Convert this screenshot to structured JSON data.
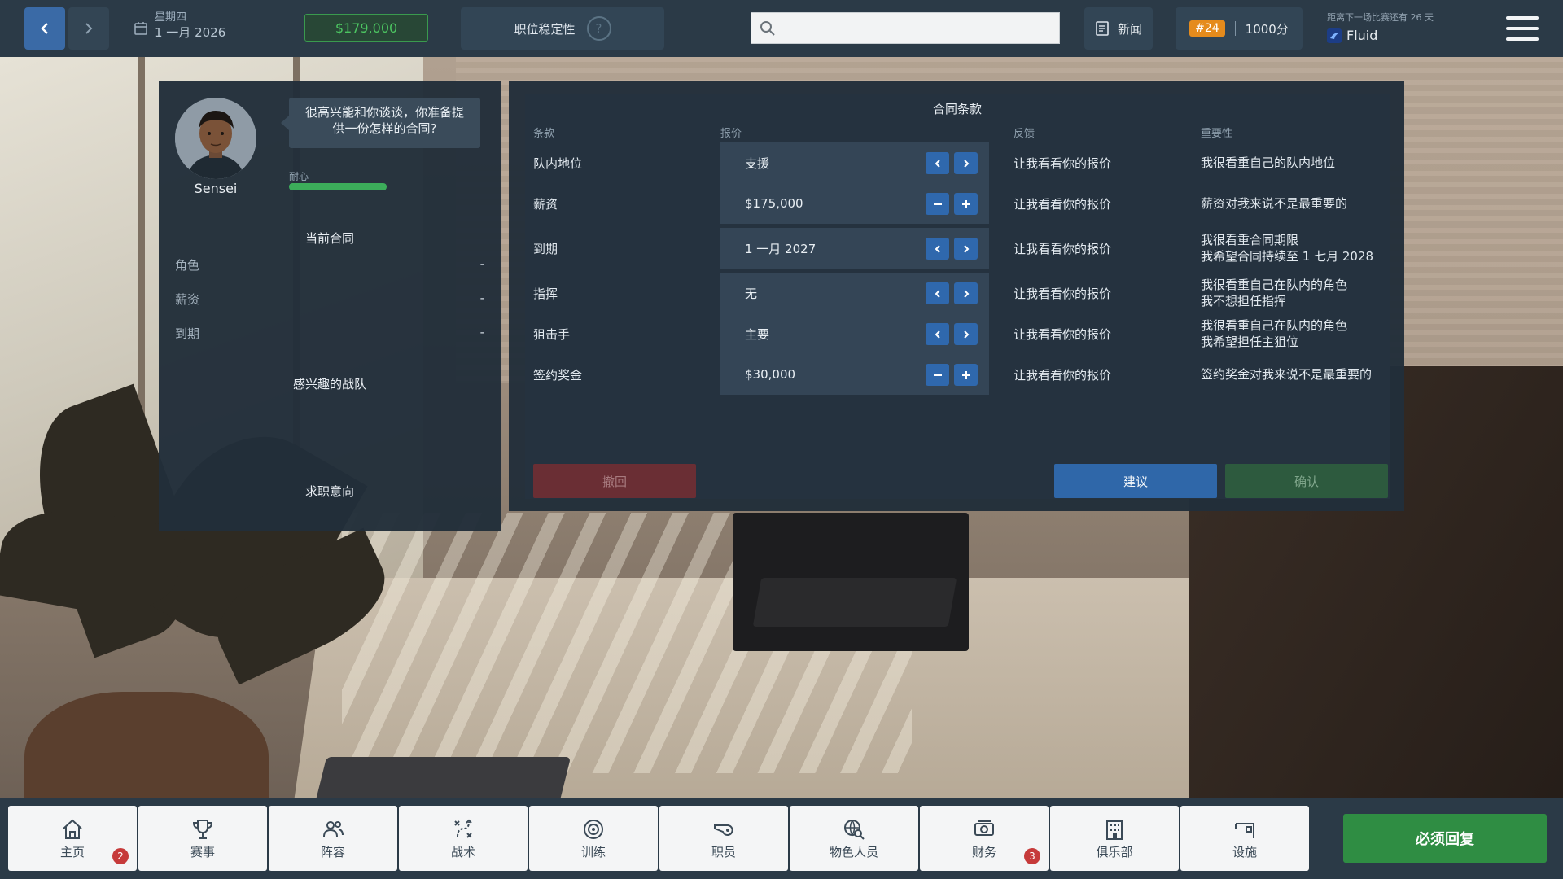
{
  "topbar": {
    "weekday": "星期四",
    "date": "1 一月 2026",
    "balance": "$179,000",
    "job_security_label": "职位稳定性",
    "job_security_help": "?",
    "search_placeholder": "",
    "news_label": "新闻",
    "rank": "#24",
    "points": "1000分",
    "next_match_text": "距离下一场比赛还有 26 天",
    "team_name": "Fluid"
  },
  "player": {
    "name": "Sensei",
    "speech": "很高兴能和你谈谈，你准备提供一份怎样的合同?",
    "patience_label": "耐心",
    "patience_fraction": 1.0
  },
  "current_contract": {
    "title": "当前合同",
    "rows": [
      {
        "label": "角色",
        "value": "-"
      },
      {
        "label": "薪资",
        "value": "-"
      },
      {
        "label": "到期",
        "value": "-"
      }
    ]
  },
  "interested_teams_title": "感兴趣的战队",
  "job_intent_title": "求职意向",
  "contract_terms": {
    "title": "合同条款",
    "headers": {
      "term": "条款",
      "offer": "报价",
      "feedback": "反馈",
      "importance": "重要性"
    },
    "rows": [
      {
        "term": "队内地位",
        "offer": "支援",
        "ctrl": "arrow",
        "feedback": "让我看看你的报价",
        "importance": "我很看重自己的队内地位"
      },
      {
        "term": "薪资",
        "offer": "$175,000",
        "ctrl": "plusminus",
        "feedback": "让我看看你的报价",
        "importance": "薪资对我来说不是最重要的"
      },
      {
        "term": "到期",
        "offer": "1 一月 2027",
        "ctrl": "arrow",
        "feedback": "让我看看你的报价",
        "importance": "我很看重合同期限\n我希望合同持续至 1 七月 2028"
      },
      {
        "term": "指挥",
        "offer": "无",
        "ctrl": "arrow",
        "feedback": "让我看看你的报价",
        "importance": "我很看重自己在队内的角色\n我不想担任指挥"
      },
      {
        "term": "狙击手",
        "offer": "主要",
        "ctrl": "arrow",
        "feedback": "让我看看你的报价",
        "importance": "我很看重自己在队内的角色\n我希望担任主狙位"
      },
      {
        "term": "签约奖金",
        "offer": "$30,000",
        "ctrl": "plusminus",
        "feedback": "让我看看你的报价",
        "importance": "签约奖金对我来说不是最重要的"
      }
    ],
    "withdraw_label": "撤回",
    "suggest_label": "建议",
    "confirm_label": "确认"
  },
  "bottom_nav": {
    "tabs": [
      {
        "label": "主页",
        "icon": "home-icon",
        "badge": "2"
      },
      {
        "label": "赛事",
        "icon": "trophy-icon",
        "badge": ""
      },
      {
        "label": "阵容",
        "icon": "people-icon",
        "badge": ""
      },
      {
        "label": "战术",
        "icon": "tactics-icon",
        "badge": ""
      },
      {
        "label": "训练",
        "icon": "target-icon",
        "badge": ""
      },
      {
        "label": "职员",
        "icon": "whistle-icon",
        "badge": ""
      },
      {
        "label": "物色人员",
        "icon": "globe-search-icon",
        "badge": ""
      },
      {
        "label": "财务",
        "icon": "money-icon",
        "badge": "3"
      },
      {
        "label": "俱乐部",
        "icon": "building-icon",
        "badge": ""
      },
      {
        "label": "设施",
        "icon": "facility-icon",
        "badge": ""
      }
    ],
    "must_reply_label": "必须回复"
  },
  "colors": {
    "bar_bg": "#2b3a47",
    "accent_blue": "#2f67a9",
    "money_green": "#4cc561",
    "reply_green": "#2f8d43",
    "rank_orange": "#e58b1c",
    "badge_red": "#c63a3a"
  }
}
